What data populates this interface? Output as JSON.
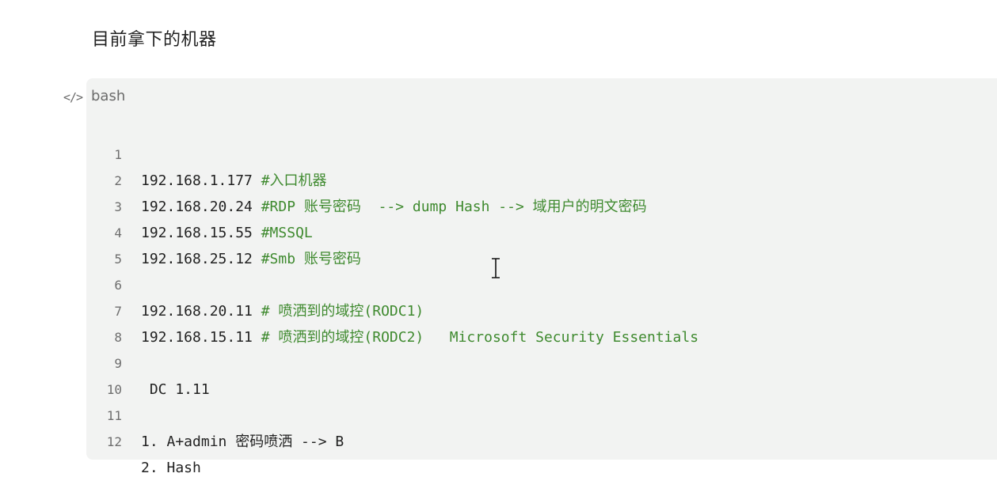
{
  "heading": "目前拿下的机器",
  "code_icon": "</>",
  "language": "bash",
  "lines": [
    {
      "num": "1",
      "code": "192.168.1.177 ",
      "comment": "#入口机器"
    },
    {
      "num": "2",
      "code": "192.168.20.24 ",
      "comment": "#RDP 账号密码  --> dump Hash --> 域用户的明文密码"
    },
    {
      "num": "3",
      "code": "192.168.15.55 ",
      "comment": "#MSSQL"
    },
    {
      "num": "4",
      "code": "192.168.25.12 ",
      "comment": "#Smb 账号密码"
    },
    {
      "num": "5",
      "code": "",
      "comment": ""
    },
    {
      "num": "6",
      "code": "192.168.20.11 ",
      "comment": "# 喷洒到的域控(RODC1)"
    },
    {
      "num": "7",
      "code": "192.168.15.11 ",
      "comment": "# 喷洒到的域控(RODC2)   Microsoft Security Essentials"
    },
    {
      "num": "8",
      "code": "",
      "comment": ""
    },
    {
      "num": "9",
      "code": " DC 1.11",
      "comment": ""
    },
    {
      "num": "10",
      "code": "",
      "comment": ""
    },
    {
      "num": "11",
      "code": "1. A+admin 密码喷洒 --> B",
      "comment": ""
    },
    {
      "num": "12",
      "code": "2. Hash",
      "comment": ""
    }
  ],
  "colors": {
    "comment": "#3f8a2f",
    "code": "#222222",
    "line_number": "#6e6e6e",
    "block_background": "#f2f3f2"
  },
  "icons": {
    "code_icon": "code-brackets-icon",
    "cursor": "text-cursor-ibeam"
  }
}
